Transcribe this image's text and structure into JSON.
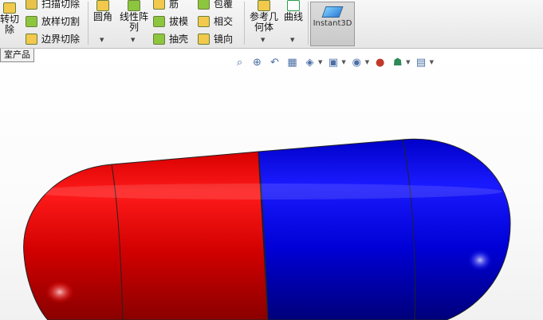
{
  "toolbar": {
    "rotate_cut_line1": "转切",
    "rotate_cut_line2": "除",
    "sweep_cut": "扫描切除",
    "loft_cut": "放样切割",
    "boundary_cut": "边界切除",
    "fillet": "圆角",
    "linear_pattern_line1": "线性阵",
    "linear_pattern_line2": "列",
    "rib": "筋",
    "draft": "拔模",
    "shell": "抽壳",
    "wrap": "包覆",
    "intersect": "相交",
    "mirror": "镜向",
    "ref_geometry_line1": "参考几",
    "ref_geometry_line2": "何体",
    "curves": "曲线",
    "instant3d": "Instant3D"
  },
  "tab": {
    "label": "室产品"
  },
  "heads_up": {
    "icons": [
      "zoom-to-fit-icon",
      "zoom-area-icon",
      "previous-view-icon",
      "section-view-icon",
      "view-orientation-icon",
      "display-style-icon",
      "hide-show-icon",
      "edit-appearance-icon",
      "scene-icon",
      "view-settings-icon"
    ]
  },
  "model": {
    "name": "capsule",
    "colors": {
      "left_half": "#e00000",
      "right_half": "#0000e6"
    }
  }
}
